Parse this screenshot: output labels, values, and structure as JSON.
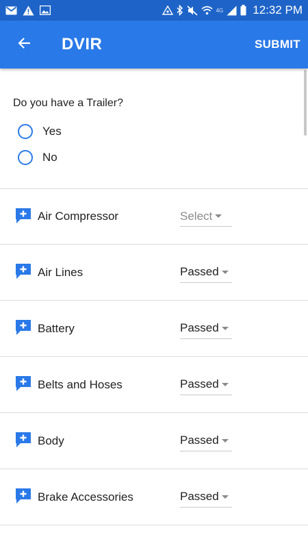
{
  "status_bar": {
    "time": "12:32 PM",
    "network_label": "4G",
    "left_icons": [
      "gmail-icon",
      "warning-icon",
      "image-icon"
    ],
    "right_icons": [
      "data-saver-icon",
      "bluetooth-icon",
      "mute-icon",
      "wifi-icon",
      "signal-icon",
      "battery-icon"
    ]
  },
  "app_bar": {
    "title": "DVIR",
    "submit_label": "SUBMIT",
    "back_icon": "arrow-back-icon",
    "background": "#2a79e8"
  },
  "trailer_question": {
    "question": "Do you have a Trailer?",
    "options": [
      "Yes",
      "No"
    ],
    "selected": null
  },
  "inspection_items": [
    {
      "label": "Air Compressor",
      "value": "Select",
      "is_placeholder": true
    },
    {
      "label": "Air Lines",
      "value": "Passed",
      "is_placeholder": false
    },
    {
      "label": "Battery",
      "value": "Passed",
      "is_placeholder": false
    },
    {
      "label": "Belts and Hoses",
      "value": "Passed",
      "is_placeholder": false
    },
    {
      "label": "Body",
      "value": "Passed",
      "is_placeholder": false
    },
    {
      "label": "Brake Accessories",
      "value": "Passed",
      "is_placeholder": false
    }
  ],
  "colors": {
    "accent": "#2a79e8",
    "status_bar": "#1e64c8",
    "divider": "#dcdcdc"
  }
}
